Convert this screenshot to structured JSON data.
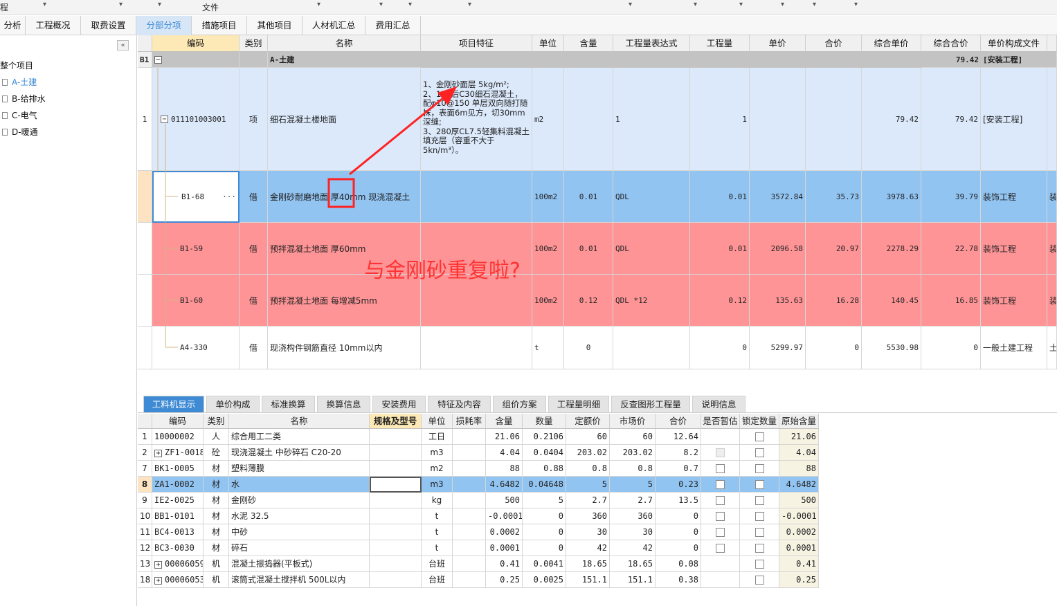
{
  "menubar": {
    "left_fragment": "程",
    "file": "文件"
  },
  "tabs": [
    {
      "label": "分析"
    },
    {
      "label": "工程概况"
    },
    {
      "label": "取费设置"
    },
    {
      "label": "分部分项"
    },
    {
      "label": "措施项目"
    },
    {
      "label": "其他项目"
    },
    {
      "label": "人材机汇总"
    },
    {
      "label": "费用汇总"
    }
  ],
  "active_tab": "分部分项",
  "sidebar": {
    "collapse_icon": "«",
    "root": "整个项目",
    "items": [
      {
        "label": "A-土建"
      },
      {
        "label": "B-给排水"
      },
      {
        "label": "C-电气"
      },
      {
        "label": "D-暖通"
      }
    ]
  },
  "grid": {
    "headers": [
      "编码",
      "类别",
      "名称",
      "项目特征",
      "单位",
      "含量",
      "工程量表达式",
      "工程量",
      "单价",
      "合价",
      "综合单价",
      "综合合价",
      "单价构成文件",
      ""
    ],
    "group_row": {
      "id": "B1",
      "name": "A-土建",
      "total": "79.42",
      "file": "[安装工程]"
    },
    "main_row": {
      "num": "1",
      "code": "011101003001",
      "type": "项",
      "name": "细石混凝土楼地面",
      "feature": "1、金刚砂面层 5kg/m²;\n2、120后C30细石混凝土，配φ10@150 单层双向随打随抹，表面6m见方，切30mm深缝;\n3、280厚CL7.5轻集料混凝土填充层（容重不大于5kn/m³）。",
      "unit": "m2",
      "content": "",
      "expr": "1",
      "qty": "1",
      "price": "",
      "total": "",
      "cprice": "79.42",
      "ctotal": "79.42",
      "file": "[安装工程]",
      "extra": ""
    },
    "rows": [
      {
        "code": "B1-68",
        "more": "···",
        "type": "借",
        "name": "金刚砂耐磨地面 厚40mm 现浇混凝土",
        "unit": "100m2",
        "content": "0.01",
        "expr": "QDL",
        "qty": "0.01",
        "price": "3572.84",
        "total": "35.73",
        "cprice": "3978.63",
        "ctotal": "39.79",
        "file": "装饰工程",
        "extra": "装"
      },
      {
        "code": "B1-59",
        "more": "",
        "type": "借",
        "name": "预拌混凝土地面 厚60mm",
        "unit": "100m2",
        "content": "0.01",
        "expr": "QDL",
        "qty": "0.01",
        "price": "2096.58",
        "total": "20.97",
        "cprice": "2278.29",
        "ctotal": "22.78",
        "file": "装饰工程",
        "extra": "装"
      },
      {
        "code": "B1-60",
        "more": "",
        "type": "借",
        "name": "预拌混凝土地面 每增减5mm",
        "unit": "100m2",
        "content": "0.12",
        "expr": "QDL *12",
        "qty": "0.12",
        "price": "135.63",
        "total": "16.28",
        "cprice": "140.45",
        "ctotal": "16.85",
        "file": "装饰工程",
        "extra": "装"
      },
      {
        "code": "A4-330",
        "more": "",
        "type": "借",
        "name": "现浇构件钢筋直径 10mm以内",
        "unit": "t",
        "content": "0",
        "expr": "",
        "qty": "0",
        "price": "5299.97",
        "total": "0",
        "cprice": "5530.98",
        "ctotal": "0",
        "file": "一般土建工程",
        "extra": "土"
      }
    ]
  },
  "annotation": "与金刚砂重复啦?",
  "bottom_tabs": [
    {
      "label": "工料机显示"
    },
    {
      "label": "单价构成"
    },
    {
      "label": "标准换算"
    },
    {
      "label": "换算信息"
    },
    {
      "label": "安装费用"
    },
    {
      "label": "特征及内容"
    },
    {
      "label": "组价方案"
    },
    {
      "label": "工程量明细"
    },
    {
      "label": "反查图形工程量"
    },
    {
      "label": "说明信息"
    }
  ],
  "lower_grid": {
    "headers": [
      "",
      "编码",
      "类别",
      "名称",
      "规格及型号",
      "单位",
      "损耗率",
      "含量",
      "数量",
      "定额价",
      "市场价",
      "合价",
      "是否暂估",
      "锁定数量",
      "原始含量"
    ],
    "rows": [
      {
        "n": "1",
        "code": "10000002",
        "plus": false,
        "type": "人",
        "name": "综合用工二类",
        "unit": "工日",
        "loss": "",
        "content": "21.06",
        "qty": "0.2106",
        "quota": "60",
        "market": "60",
        "total": "12.64",
        "est": "none",
        "lock": "box",
        "orig": "21.06"
      },
      {
        "n": "2",
        "code": "ZF1-0018",
        "plus": true,
        "type": "砼",
        "name": "现浇混凝土 中砂碎石 C20-20",
        "unit": "m3",
        "loss": "",
        "content": "4.04",
        "qty": "0.0404",
        "quota": "203.02",
        "market": "203.02",
        "total": "8.2",
        "est": "dis",
        "lock": "box",
        "orig": "4.04"
      },
      {
        "n": "7",
        "code": "BK1-0005",
        "plus": false,
        "type": "材",
        "name": "塑料薄膜",
        "unit": "m2",
        "loss": "",
        "content": "88",
        "qty": "0.88",
        "quota": "0.8",
        "market": "0.8",
        "total": "0.7",
        "est": "box",
        "lock": "box",
        "orig": "88"
      },
      {
        "n": "8",
        "code": "ZA1-0002",
        "plus": false,
        "type": "材",
        "name": "水",
        "unit": "m3",
        "loss": "",
        "content": "4.6482",
        "qty": "0.04648",
        "quota": "5",
        "market": "5",
        "total": "0.23",
        "est": "box",
        "lock": "box",
        "orig": "4.6482"
      },
      {
        "n": "9",
        "code": "IE2-0025",
        "plus": false,
        "type": "材",
        "name": "金刚砂",
        "unit": "kg",
        "loss": "",
        "content": "500",
        "qty": "5",
        "quota": "2.7",
        "market": "2.7",
        "total": "13.5",
        "est": "box",
        "lock": "box",
        "orig": "500"
      },
      {
        "n": "10",
        "code": "BB1-0101",
        "plus": false,
        "type": "材",
        "name": "水泥 32.5",
        "unit": "t",
        "loss": "",
        "content": "-0.0001",
        "qty": "0",
        "quota": "360",
        "market": "360",
        "total": "0",
        "est": "box",
        "lock": "box",
        "orig": "-0.0001"
      },
      {
        "n": "11",
        "code": "BC4-0013",
        "plus": false,
        "type": "材",
        "name": "中砂",
        "unit": "t",
        "loss": "",
        "content": "0.0002",
        "qty": "0",
        "quota": "30",
        "market": "30",
        "total": "0",
        "est": "box",
        "lock": "box",
        "orig": "0.0002"
      },
      {
        "n": "12",
        "code": "BC3-0030",
        "plus": false,
        "type": "材",
        "name": "碎石",
        "unit": "t",
        "loss": "",
        "content": "0.0001",
        "qty": "0",
        "quota": "42",
        "market": "42",
        "total": "0",
        "est": "box",
        "lock": "box",
        "orig": "0.0001"
      },
      {
        "n": "13",
        "code": "00006059",
        "plus": true,
        "type": "机",
        "name": "混凝土振捣器(平板式)",
        "unit": "台班",
        "loss": "",
        "content": "0.41",
        "qty": "0.0041",
        "quota": "18.65",
        "market": "18.65",
        "total": "0.08",
        "est": "none",
        "lock": "box",
        "orig": "0.41"
      },
      {
        "n": "18",
        "code": "00006053",
        "plus": true,
        "type": "机",
        "name": "滚筒式混凝土搅拌机 500L以内",
        "unit": "台班",
        "loss": "",
        "content": "0.25",
        "qty": "0.0025",
        "quota": "151.1",
        "market": "151.1",
        "total": "0.38",
        "est": "none",
        "lock": "box",
        "orig": "0.25"
      }
    ]
  },
  "colors": {
    "accent": "#3e8ad4",
    "selected_row": "#92c4f2",
    "duplicate_row": "#fe9496",
    "main_row": "#dbe9fb",
    "group_row": "#c3c3c3",
    "annotation": "#ff3333"
  }
}
